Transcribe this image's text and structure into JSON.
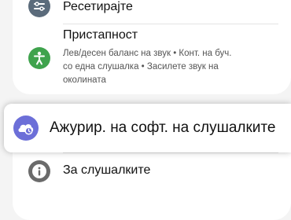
{
  "settings": {
    "equalizer": {
      "label": "Ресетирајте",
      "icon": "equalizer-icon"
    },
    "accessibility": {
      "label": "Пристапност",
      "description_lines": [
        "Лев/десен баланс на звук  •  Конт. на буч.",
        "со една слушалка  •  Засилете звук на",
        "околината"
      ],
      "icon": "accessibility-icon",
      "icon_color": "#3fa34d"
    },
    "software_update": {
      "label": "Ажурир. на софт. на слушалките",
      "icon": "software-update-icon",
      "icon_color": "#6c6fd8"
    },
    "about": {
      "label": "За слушалките",
      "icon": "info-icon",
      "icon_color": "#6b6b6b"
    }
  }
}
